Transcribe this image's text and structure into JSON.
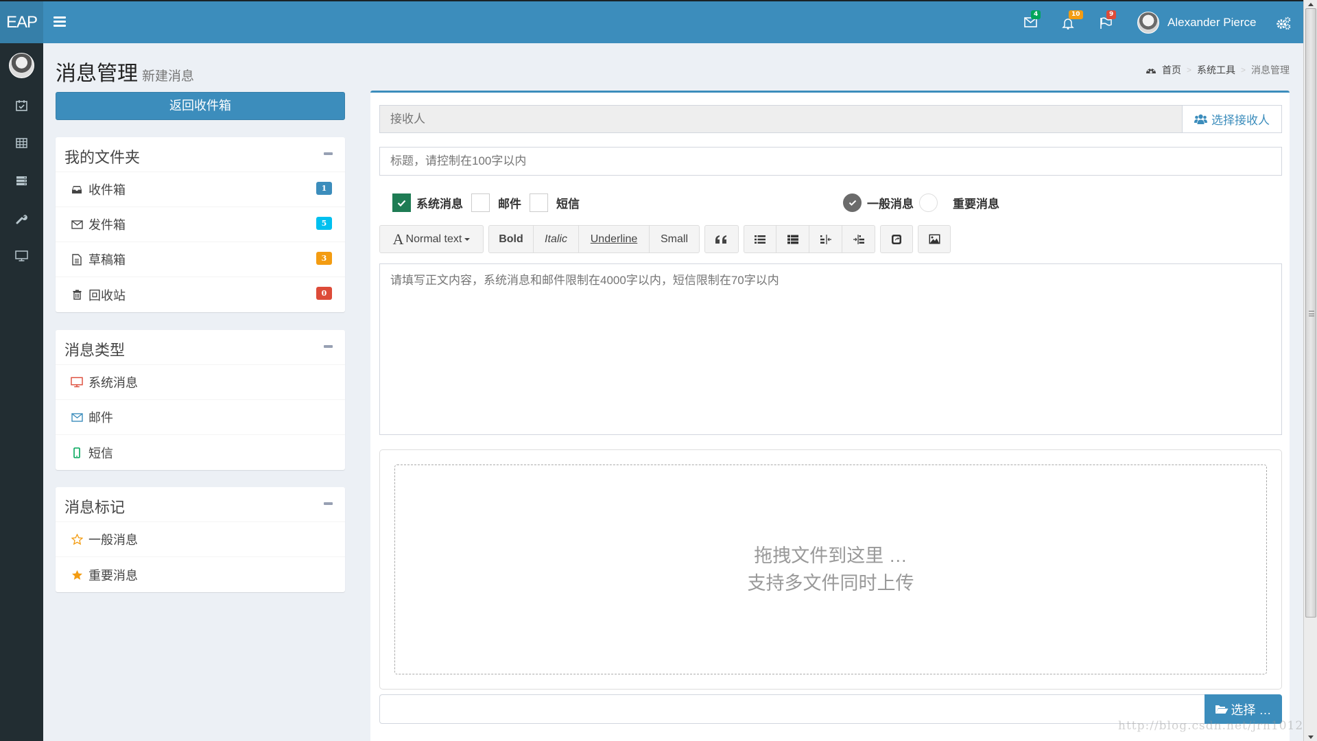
{
  "app": {
    "logo": "EAP",
    "colors": {
      "primary": "#3c8dbc",
      "sidebar": "#222d32",
      "green": "#00a65a",
      "aqua": "#00c0ef",
      "orange": "#f39c12",
      "red": "#dd4b39"
    }
  },
  "header": {
    "messages_badge": "4",
    "notifications_badge": "10",
    "tasks_badge": "9",
    "user_name": "Alexander Pierce"
  },
  "sidebar": {
    "icons": [
      "calendar-check-icon",
      "table-icon",
      "server-icon",
      "wrench-icon",
      "desktop-icon"
    ]
  },
  "page": {
    "title": "消息管理",
    "subtitle": "新建消息",
    "breadcrumb": [
      {
        "label": "首页",
        "icon": "dashboard-icon"
      },
      {
        "label": "系统工具"
      },
      {
        "label": "消息管理"
      }
    ]
  },
  "left": {
    "back_button": "返回收件箱",
    "folders": {
      "title": "我的文件夹",
      "items": [
        {
          "label": "收件箱",
          "icon": "inbox-icon",
          "count": "1",
          "color": "#3c8dbc"
        },
        {
          "label": "发件箱",
          "icon": "envelope-icon",
          "count": "5",
          "color": "#00c0ef"
        },
        {
          "label": "草稿箱",
          "icon": "file-text-icon",
          "count": "3",
          "color": "#f39c12"
        },
        {
          "label": "回收站",
          "icon": "trash-icon",
          "count": "0",
          "color": "#dd4b39"
        }
      ]
    },
    "types": {
      "title": "消息类型",
      "items": [
        {
          "label": "系统消息",
          "icon": "desktop-icon"
        },
        {
          "label": "邮件",
          "icon": "envelope-icon"
        },
        {
          "label": "短信",
          "icon": "mobile-icon"
        }
      ]
    },
    "marks": {
      "title": "消息标记",
      "items": [
        {
          "label": "一般消息",
          "icon": "star-outline-icon"
        },
        {
          "label": "重要消息",
          "icon": "star-icon"
        }
      ]
    }
  },
  "compose": {
    "recipient_placeholder": "接收人",
    "select_recipient": "选择接收人",
    "title_placeholder": "标题，请控制在100字以内",
    "channels": [
      {
        "label": "系统消息",
        "checked": true
      },
      {
        "label": "邮件",
        "checked": false
      },
      {
        "label": "短信",
        "checked": false
      }
    ],
    "priority": [
      {
        "label": "一般消息",
        "selected": true
      },
      {
        "label": "重要消息",
        "selected": false
      }
    ],
    "toolbar": {
      "format": "Normal text",
      "bold": "Bold",
      "italic": "Italic",
      "underline": "Underline",
      "small": "Small",
      "icons": [
        "quote-icon",
        "unordered-list-icon",
        "ordered-list-icon",
        "outdent-icon",
        "indent-icon",
        "link-icon",
        "image-icon"
      ]
    },
    "body_placeholder": "请填写正文内容，系统消息和邮件限制在4000字以内，短信限制在70字以内",
    "drop_line1": "拖拽文件到这里 …",
    "drop_line2": "支持多文件同时上传",
    "choose_button": "选择 …"
  },
  "watermark": "http://blog.csdn.net/jrn1012"
}
